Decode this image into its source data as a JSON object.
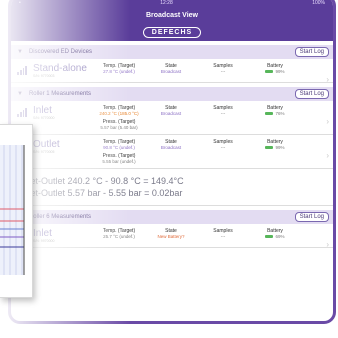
{
  "status": {
    "time": "12:28",
    "battery": "100%"
  },
  "nav": {
    "title": "Broadcast View"
  },
  "logo": "DEFECHS",
  "sections": [
    {
      "title": "Discovered ED Devices",
      "start_log": "Start Log",
      "devices": [
        {
          "name": "Stand-alone",
          "sn": "S/N: 9770003",
          "temp_label": "Temp. (Target)",
          "temp_value": "27.8 °C (undef.)",
          "state_label": "State",
          "state_value": "Broadcast",
          "samples_label": "Samples",
          "samples_value": "---",
          "battery_label": "Battery",
          "battery_value": "99%"
        }
      ]
    },
    {
      "title": "Roller 1 Measurements",
      "start_log": "Start Log",
      "devices": [
        {
          "name": "Inlet",
          "sn": "S/N: 9770000",
          "temp_label": "Temp. (Target)",
          "temp_value": "240.2 °C (185.0 °C)",
          "press_label": "Press. (Target)",
          "press_value": "5.57 bar (5.40 bar)",
          "state_label": "State",
          "state_value": "Broadcast",
          "samples_label": "Samples",
          "samples_value": "---",
          "battery_label": "Battery",
          "battery_value": "76%"
        },
        {
          "name": "Outlet",
          "sn": "S/N: 9770005",
          "temp_label": "Temp. (Target)",
          "temp_value": "90.8 °C (undef.)",
          "press_label": "Press. (Target)",
          "press_value": "5.55 bar (undef.)",
          "state_label": "State",
          "state_value": "Broadcast",
          "samples_label": "Samples",
          "samples_value": "---",
          "battery_label": "Battery",
          "battery_value": "99%"
        }
      ],
      "calc_line1": "Inlet-Outlet 240.2 °C - 90.8 °C = 149.4°C",
      "calc_line2": "Inlet-Outlet 5.57 bar - 5.55 bar = 0.02bar"
    },
    {
      "title": "Roller 6 Measurements",
      "start_log": "Start Log",
      "devices": [
        {
          "name": "Inlet",
          "sn": "S/N: 9970000",
          "temp_label": "Temp. (Target)",
          "temp_value": "25.7 °C (undef.)",
          "state_label": "State",
          "state_value": "New Battery?",
          "samples_label": "Samples",
          "samples_value": "---",
          "battery_label": "Battery",
          "battery_value": "69%"
        }
      ]
    }
  ]
}
